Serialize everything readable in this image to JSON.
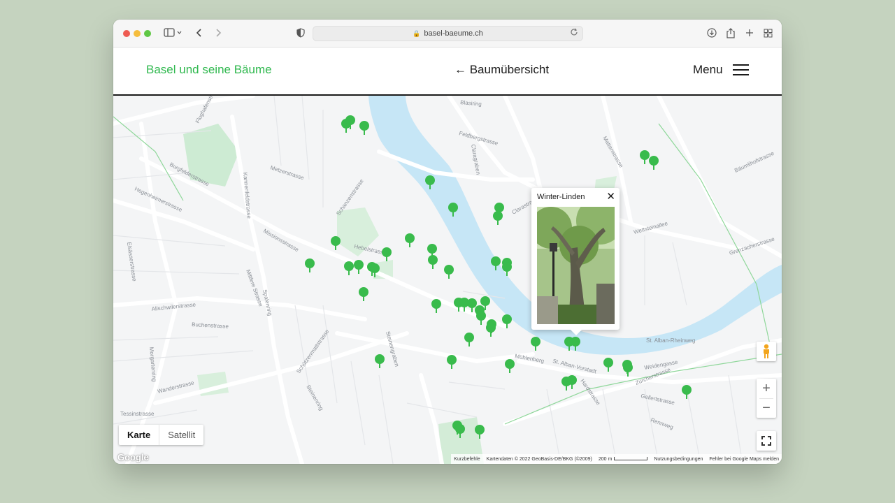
{
  "browser": {
    "url": "basel-baeume.ch"
  },
  "site": {
    "brand": "Basel und seine Bäume",
    "back_link": "← Baumübersicht",
    "menu_label": "Menu"
  },
  "popup": {
    "title": "Winter-Linden",
    "close": "✕"
  },
  "map": {
    "streets": [
      "Flughafenstrasse",
      "Burgfelderstrasse",
      "Metzerstrasse",
      "Kannenfeldstrasse",
      "Hegenheimerstrasse",
      "Missionsstrasse",
      "Schanzenstrasse",
      "Feldbergstrasse",
      "Mattenstrasse",
      "Bäumlihofstrasse",
      "Wettsteinallee",
      "Grenzacherstrasse",
      "Allschwilerstrasse",
      "Spalenring",
      "Schützenmattstrasse",
      "Steinengraben",
      "Wanderstrasse",
      "Morgartenring",
      "Steinenring",
      "Hardstrasse",
      "Zürcherstrasse",
      "St. Alban-Rheinweg",
      "Weidengasse",
      "Gellertstrasse",
      "Rennweg",
      "Hebelstrasse",
      "Blasiring",
      "Claragraben",
      "Clarastrasse",
      "Mühlenberg",
      "St. Alban-Vorstadt",
      "Buchenstrasse",
      "Elsässerstrasse",
      "Mittlere Strasse",
      "Tessinstrasse"
    ],
    "map_type": {
      "map": "Karte",
      "satellite": "Satellit"
    },
    "google_logo": "Google",
    "attribution": {
      "shortcuts": "Kurzbefehle",
      "data": "Kartendaten © 2022 GeoBasis-DE/BKG (©2009)",
      "scale": "200 m",
      "terms": "Nutzungsbedingungen",
      "report": "Fehler bei Google Maps melden"
    },
    "zoom_in": "+",
    "zoom_out": "−",
    "colors": {
      "pin": "#39bb4c",
      "water": "#c6e6f6",
      "park": "#cdebd3",
      "brand": "#2fb84e"
    },
    "tree_marker_count": 46
  }
}
